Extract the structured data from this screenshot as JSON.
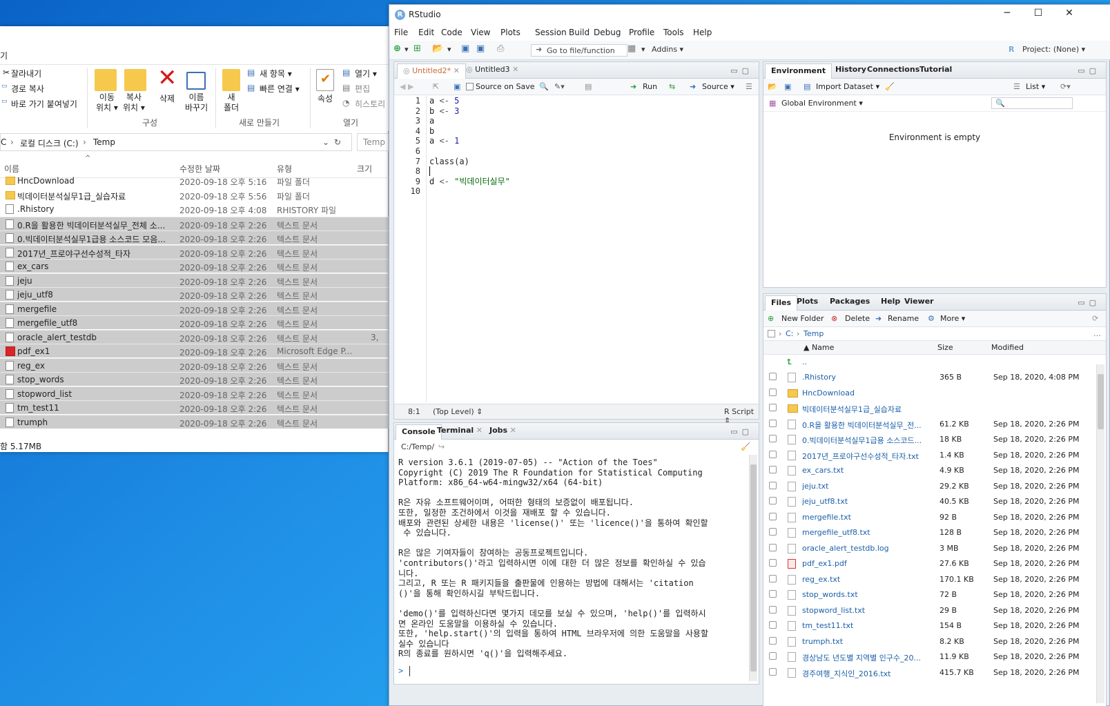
{
  "explorer": {
    "title_partial": "기",
    "clipboard": {
      "cut": "잘라내기",
      "copy_path": "경로 복사",
      "paste_shortcut": "바로 가기 붙여넣기"
    },
    "organize": {
      "move_to": "이동\n위치 ▾",
      "copy_to": "복사\n위치 ▾",
      "delete": "삭제",
      "rename": "이름\n바꾸기",
      "group": "구성"
    },
    "new": {
      "new_folder": "새\n폴더",
      "new_item": "새 항목 ▾",
      "easy_access": "빠른 연결 ▾",
      "group": "새로 만들기"
    },
    "open": {
      "properties": "속성",
      "open": "열기 ▾",
      "edit": "편집",
      "history": "히스토리",
      "group": "열기"
    },
    "address": {
      "seg1": "C",
      "seg2": "로컬 디스크 (C:)",
      "seg3": "Temp"
    },
    "search_placeholder": "Temp",
    "columns": {
      "name": "이름",
      "date": "수정한 날짜",
      "type": "유형",
      "size": "크기"
    },
    "files": [
      {
        "name": "HncDownload",
        "date": "2020-09-18 오후 5:16",
        "type": "파일 폴더",
        "size": "",
        "icon": "folder",
        "sel": false
      },
      {
        "name": "빅데이터분석실무1급_실습자료",
        "date": "2020-09-18 오후 5:56",
        "type": "파일 폴더",
        "size": "",
        "icon": "folder",
        "sel": false
      },
      {
        "name": ".Rhistory",
        "date": "2020-09-18 오후 4:08",
        "type": "RHISTORY 파일",
        "size": "",
        "icon": "file",
        "sel": false
      },
      {
        "name": "0.R을 활용한 빅데이터분석실무_전체 소...",
        "date": "2020-09-18 오후 2:26",
        "type": "텍스트 문서",
        "size": "",
        "icon": "file",
        "sel": true
      },
      {
        "name": "0.빅데이터분석실무1급용 소스코드 모음...",
        "date": "2020-09-18 오후 2:26",
        "type": "텍스트 문서",
        "size": "",
        "icon": "file",
        "sel": true
      },
      {
        "name": "2017년_프로야구선수성적_타자",
        "date": "2020-09-18 오후 2:26",
        "type": "텍스트 문서",
        "size": "",
        "icon": "file",
        "sel": true
      },
      {
        "name": "ex_cars",
        "date": "2020-09-18 오후 2:26",
        "type": "텍스트 문서",
        "size": "",
        "icon": "file",
        "sel": true
      },
      {
        "name": "jeju",
        "date": "2020-09-18 오후 2:26",
        "type": "텍스트 문서",
        "size": "",
        "icon": "file",
        "sel": true
      },
      {
        "name": "jeju_utf8",
        "date": "2020-09-18 오후 2:26",
        "type": "텍스트 문서",
        "size": "",
        "icon": "file",
        "sel": true
      },
      {
        "name": "mergefile",
        "date": "2020-09-18 오후 2:26",
        "type": "텍스트 문서",
        "size": "",
        "icon": "file",
        "sel": true
      },
      {
        "name": "mergefile_utf8",
        "date": "2020-09-18 오후 2:26",
        "type": "텍스트 문서",
        "size": "",
        "icon": "file",
        "sel": true
      },
      {
        "name": "oracle_alert_testdb",
        "date": "2020-09-18 오후 2:26",
        "type": "텍스트 문서",
        "size": "3,",
        "icon": "file",
        "sel": true
      },
      {
        "name": "pdf_ex1",
        "date": "2020-09-18 오후 2:26",
        "type": "Microsoft Edge P...",
        "size": "",
        "icon": "pdf",
        "sel": true
      },
      {
        "name": "reg_ex",
        "date": "2020-09-18 오후 2:26",
        "type": "텍스트 문서",
        "size": "",
        "icon": "file",
        "sel": true
      },
      {
        "name": "stop_words",
        "date": "2020-09-18 오후 2:26",
        "type": "텍스트 문서",
        "size": "",
        "icon": "file",
        "sel": true
      },
      {
        "name": "stopword_list",
        "date": "2020-09-18 오후 2:26",
        "type": "텍스트 문서",
        "size": "",
        "icon": "file",
        "sel": true
      },
      {
        "name": "tm_test11",
        "date": "2020-09-18 오후 2:26",
        "type": "텍스트 문서",
        "size": "",
        "icon": "file",
        "sel": true
      },
      {
        "name": "trumph",
        "date": "2020-09-18 오후 2:26",
        "type": "텍스트 문서",
        "size": "",
        "icon": "file",
        "sel": true
      }
    ],
    "status": "함 5.17MB"
  },
  "rstudio": {
    "title": "RStudio",
    "menu": [
      "File",
      "Edit",
      "Code",
      "View",
      "Plots",
      "Session",
      "Build",
      "Debug",
      "Profile",
      "Tools",
      "Help"
    ],
    "toolbar": {
      "goto": "Go to file/function",
      "addins": "Addins ▾",
      "project": "Project: (None) ▾"
    },
    "editor": {
      "tabs": [
        "Untitled2*",
        "Untitled3"
      ],
      "source_on_save": "Source on Save",
      "run": "Run",
      "source": "Source ▾",
      "lines": [
        "1",
        "2",
        "3",
        "4",
        "5",
        "6",
        "7",
        "8",
        "9",
        "10"
      ],
      "position": "8:1",
      "scope": "(Top Level) ⇕",
      "filetype": "R Script ⇕"
    },
    "env": {
      "tabs": [
        "Environment",
        "History",
        "Connections",
        "Tutorial"
      ],
      "import": "Import Dataset ▾",
      "list": "List ▾",
      "global": "Global Environment ▾",
      "empty": "Environment is empty"
    },
    "console": {
      "tabs": [
        "Console",
        "Terminal",
        "Jobs"
      ],
      "path": "C:/Temp/",
      "text": "R version 3.6.1 (2019-07-05) -- \"Action of the Toes\"\nCopyright (C) 2019 The R Foundation for Statistical Computing\nPlatform: x86_64-w64-mingw32/x64 (64-bit)\n\nR은 자유 소프트웨어이며, 어떠한 형태의 보증없이 배포됩니다.\n또한, 일정한 조건하에서 이것을 재배포 할 수 있습니다.\n배포와 관련된 상세한 내용은 'license()' 또는 'licence()'을 통하여 확인할\n 수 있습니다.\n\nR은 많은 기여자들이 참여하는 공동프로젝트입니다.\n'contributors()'라고 입력하시면 이에 대한 더 많은 정보를 확인하실 수 있습\n니다.\n그리고, R 또는 R 패키지들을 출판물에 인용하는 방법에 대해서는 'citation\n()'을 통해 확인하시길 부탁드립니다.\n\n'demo()'를 입력하신다면 몇가지 데모를 보실 수 있으며, 'help()'를 입력하시\n면 온라인 도움말을 이용하실 수 있습니다.\n또한, 'help.start()'의 입력을 통하여 HTML 브라우저에 의한 도움말을 사용할\n실수 있습니다\nR의 종료를 원하시면 'q()'을 입력해주세요.",
      "prompt": ">"
    },
    "files": {
      "tabs": [
        "Files",
        "Plots",
        "Packages",
        "Help",
        "Viewer"
      ],
      "new_folder": "New Folder",
      "delete": "Delete",
      "rename": "Rename",
      "more": "More ▾",
      "crumb1": "C:",
      "crumb2": "Temp",
      "cols": {
        "name": "▲ Name",
        "size": "Size",
        "modified": "Modified"
      },
      "up": "..",
      "rows": [
        {
          "name": ".Rhistory",
          "size": "365 B",
          "mod": "Sep 18, 2020, 4:08 PM",
          "icon": "file"
        },
        {
          "name": "HncDownload",
          "size": "",
          "mod": "",
          "icon": "folder"
        },
        {
          "name": "빅데이터분석실무1급_실습자료",
          "size": "",
          "mod": "",
          "icon": "folder"
        },
        {
          "name": "0.R을 활용한 빅데이터분석실무_전...",
          "size": "61.2 KB",
          "mod": "Sep 18, 2020, 2:26 PM",
          "icon": "file"
        },
        {
          "name": "0.빅데이터분석실무1급용 소스코드...",
          "size": "18 KB",
          "mod": "Sep 18, 2020, 2:26 PM",
          "icon": "file"
        },
        {
          "name": "2017년_프로야구선수성적_타자.txt",
          "size": "1.4 KB",
          "mod": "Sep 18, 2020, 2:26 PM",
          "icon": "file"
        },
        {
          "name": "ex_cars.txt",
          "size": "4.9 KB",
          "mod": "Sep 18, 2020, 2:26 PM",
          "icon": "file"
        },
        {
          "name": "jeju.txt",
          "size": "29.2 KB",
          "mod": "Sep 18, 2020, 2:26 PM",
          "icon": "file"
        },
        {
          "name": "jeju_utf8.txt",
          "size": "40.5 KB",
          "mod": "Sep 18, 2020, 2:26 PM",
          "icon": "file"
        },
        {
          "name": "mergefile.txt",
          "size": "92 B",
          "mod": "Sep 18, 2020, 2:26 PM",
          "icon": "file"
        },
        {
          "name": "mergefile_utf8.txt",
          "size": "128 B",
          "mod": "Sep 18, 2020, 2:26 PM",
          "icon": "file"
        },
        {
          "name": "oracle_alert_testdb.log",
          "size": "3 MB",
          "mod": "Sep 18, 2020, 2:26 PM",
          "icon": "file"
        },
        {
          "name": "pdf_ex1.pdf",
          "size": "27.6 KB",
          "mod": "Sep 18, 2020, 2:26 PM",
          "icon": "pdf"
        },
        {
          "name": "reg_ex.txt",
          "size": "170.1 KB",
          "mod": "Sep 18, 2020, 2:26 PM",
          "icon": "file"
        },
        {
          "name": "stop_words.txt",
          "size": "72 B",
          "mod": "Sep 18, 2020, 2:26 PM",
          "icon": "file"
        },
        {
          "name": "stopword_list.txt",
          "size": "29 B",
          "mod": "Sep 18, 2020, 2:26 PM",
          "icon": "file"
        },
        {
          "name": "tm_test11.txt",
          "size": "154 B",
          "mod": "Sep 18, 2020, 2:26 PM",
          "icon": "file"
        },
        {
          "name": "trumph.txt",
          "size": "8.2 KB",
          "mod": "Sep 18, 2020, 2:26 PM",
          "icon": "file"
        },
        {
          "name": "경상남도 년도별 지역별 인구수_20...",
          "size": "11.9 KB",
          "mod": "Sep 18, 2020, 2:26 PM",
          "icon": "file"
        },
        {
          "name": "경주여행_지식인_2016.txt",
          "size": "415.7 KB",
          "mod": "Sep 18, 2020, 2:26 PM",
          "icon": "file"
        }
      ]
    }
  }
}
